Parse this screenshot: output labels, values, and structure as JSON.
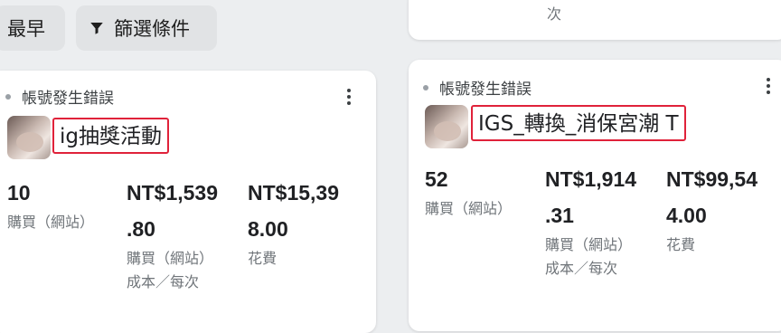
{
  "toolbar": {
    "sort_label": "最早",
    "filter_label": "篩選條件",
    "filter_icon": "filter-funnel-icon"
  },
  "top_card": {
    "text": "次"
  },
  "cards": [
    {
      "status": "帳號發生錯誤",
      "campaign_name": "ig抽獎活動",
      "metrics": [
        {
          "value": "10",
          "label": "購買（網站）"
        },
        {
          "value_line1": "NT$1,539",
          "value_line2": ".80",
          "label_line1": "購買（網站）",
          "label_line2": "成本／每次"
        },
        {
          "value_line1": "NT$15,39",
          "value_line2": "8.00",
          "label": "花費"
        }
      ]
    },
    {
      "status": "帳號發生錯誤",
      "campaign_name": "IGS_轉換_消保宮潮 T",
      "metrics": [
        {
          "value": "52",
          "label": "購買（網站）"
        },
        {
          "value_line1": "NT$1,914",
          "value_line2": ".31",
          "label_line1": "購買（網站）",
          "label_line2": "成本／每次"
        },
        {
          "value_line1": "NT$99,54",
          "value_line2": "4.00",
          "label": "花費"
        }
      ]
    }
  ],
  "colors": {
    "highlight_border": "#e0223a",
    "chip_background": "#e1e3e5",
    "page_background": "#eceef0",
    "card_background": "#ffffff"
  }
}
